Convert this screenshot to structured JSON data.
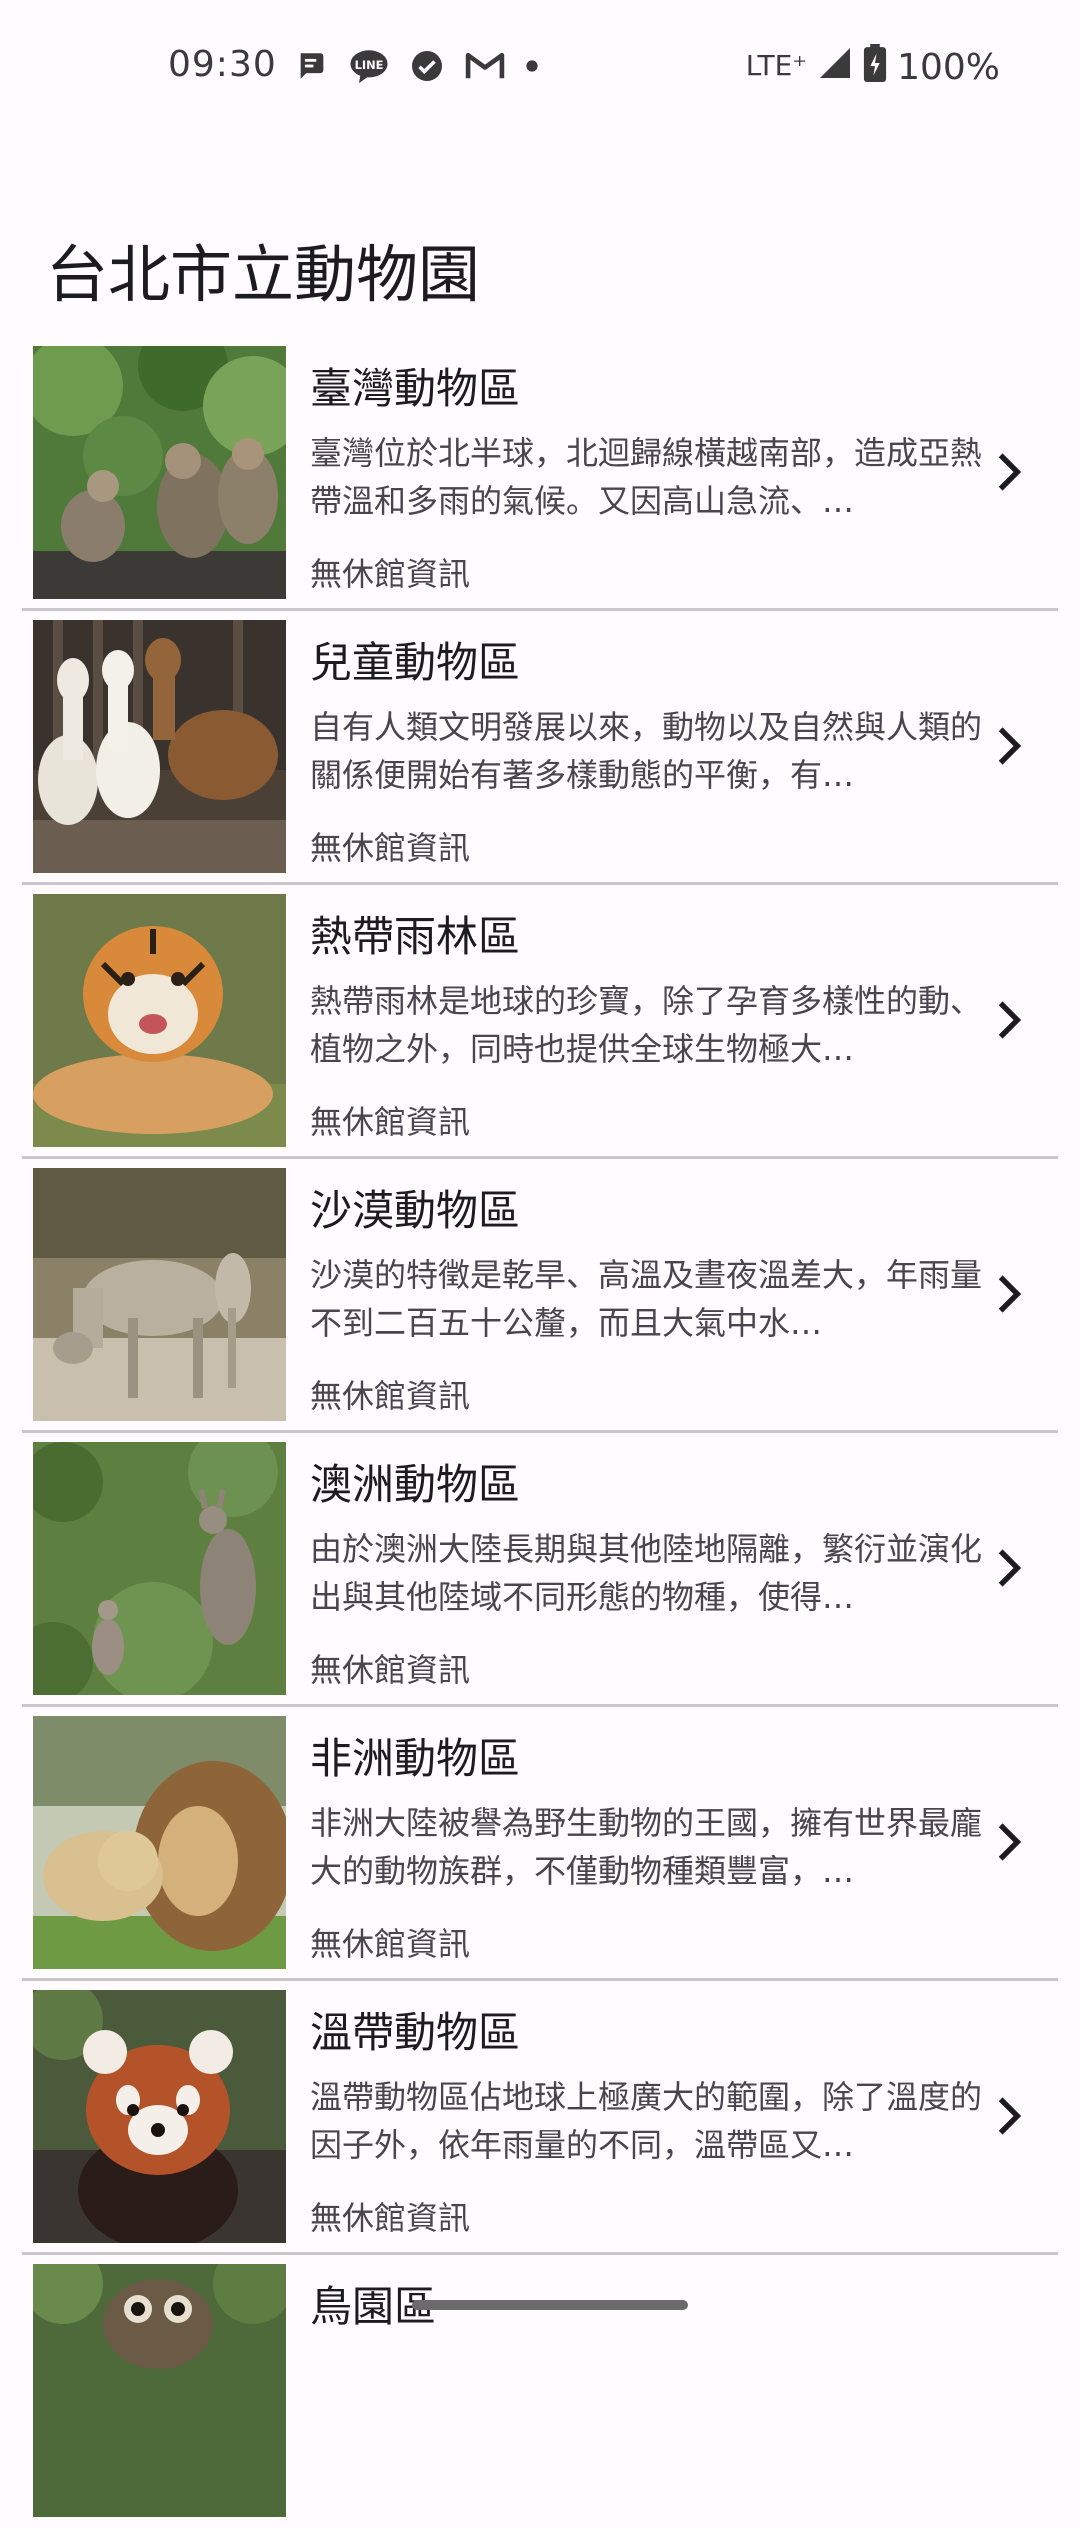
{
  "status_bar": {
    "time": "09:30",
    "network": "LTE⁺",
    "battery": "100%",
    "notification_icons": [
      "message-icon",
      "line-icon",
      "check-icon",
      "gmail-icon",
      "dot-icon"
    ]
  },
  "app": {
    "title": "台北市立動物園"
  },
  "areas": [
    {
      "title": "臺灣動物區",
      "desc": "臺灣位於北半球，北迴歸線橫越南部，造成亞熱帶溫和多雨的氣候。又因高山急流、…",
      "meta": "無休館資訊",
      "image": "formosan-macaques"
    },
    {
      "title": "兒童動物區",
      "desc": "自有人類文明發展以來，動物以及自然與人類的關係便開始有著多樣動態的平衡，有…",
      "meta": "無休館資訊",
      "image": "alpacas"
    },
    {
      "title": "熱帶雨林區",
      "desc": "熱帶雨林是地球的珍寶，除了孕育多樣性的動、植物之外，同時也提供全球生物極大…",
      "meta": "無休館資訊",
      "image": "tiger"
    },
    {
      "title": "沙漠動物區",
      "desc": "沙漠的特徵是乾旱、高溫及晝夜溫差大，年雨量不到二百五十公釐，而且大氣中水…",
      "meta": "無休館資訊",
      "image": "wild-asses"
    },
    {
      "title": "澳洲動物區",
      "desc": "由於澳洲大陸長期與其他陸地隔離，繁衍並演化出與其他陸域不同形態的物種，使得…",
      "meta": "無休館資訊",
      "image": "kangaroos"
    },
    {
      "title": "非洲動物區",
      "desc": "非洲大陸被譽為野生動物的王國，擁有世界最龐大的動物族群，不僅動物種類豐富，…",
      "meta": "無休館資訊",
      "image": "lions"
    },
    {
      "title": "溫帶動物區",
      "desc": "溫帶動物區佔地球上極廣大的範圍，除了溫度的因子外，依年雨量的不同，溫帶區又…",
      "meta": "無休館資訊",
      "image": "red-panda"
    },
    {
      "title": "鳥園區",
      "desc": "",
      "meta": "",
      "image": "owl"
    }
  ]
}
